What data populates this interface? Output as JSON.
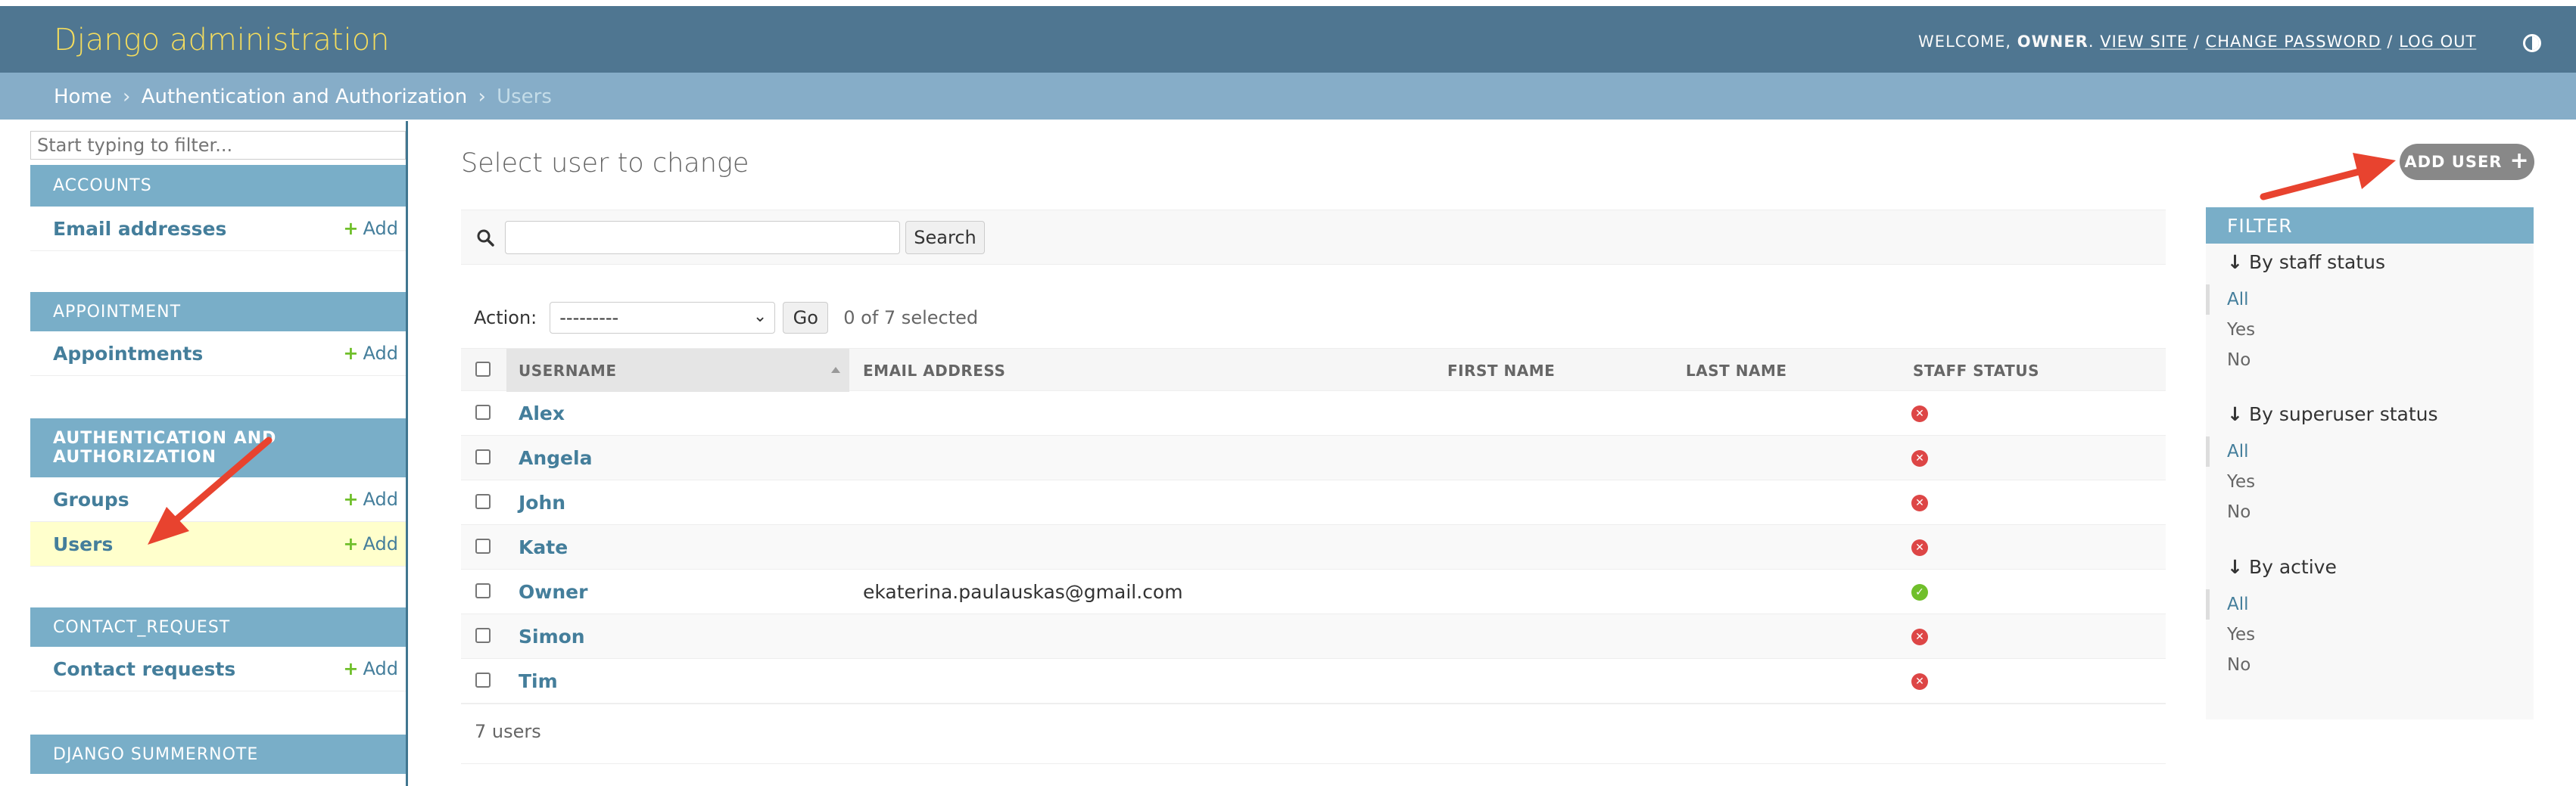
{
  "header": {
    "branding": "Django administration",
    "welcome": "Welcome,",
    "username": "Owner",
    "view_site": "View site",
    "change_password": "Change password",
    "log_out": "Log out",
    "separator": "/"
  },
  "breadcrumbs": {
    "home": "Home",
    "app": "Authentication and Authorization",
    "current": "Users",
    "separator": "›"
  },
  "sidebar": {
    "filter_placeholder": "Start typing to filter...",
    "modules": [
      {
        "caption": "Accounts",
        "models": [
          {
            "label": "Email addresses",
            "add": "Add"
          }
        ]
      },
      {
        "caption": "Appointment",
        "models": [
          {
            "label": "Appointments",
            "add": "Add"
          }
        ]
      },
      {
        "caption": "Authentication and Authorization",
        "models": [
          {
            "label": "Groups",
            "add": "Add"
          },
          {
            "label": "Users",
            "add": "Add"
          }
        ]
      },
      {
        "caption": "Contact_Request",
        "models": [
          {
            "label": "Contact requests",
            "add": "Add"
          }
        ]
      },
      {
        "caption": "Django Summernote",
        "models": []
      }
    ]
  },
  "main": {
    "title": "Select user to change",
    "add_user": "Add user",
    "search_button": "Search",
    "action_label": "Action:",
    "action_selected": "---------",
    "go_button": "Go",
    "selected_counter": "0 of 7 selected",
    "columns": [
      "Username",
      "Email address",
      "First name",
      "Last name",
      "Staff status"
    ],
    "rows": [
      {
        "username": "Alex",
        "email": "",
        "first_name": "",
        "last_name": "",
        "staff": false
      },
      {
        "username": "Angela",
        "email": "",
        "first_name": "",
        "last_name": "",
        "staff": false
      },
      {
        "username": "John",
        "email": "",
        "first_name": "",
        "last_name": "",
        "staff": false
      },
      {
        "username": "Kate",
        "email": "",
        "first_name": "",
        "last_name": "",
        "staff": false
      },
      {
        "username": "Owner",
        "email": "ekaterina.paulauskas@gmail.com",
        "first_name": "",
        "last_name": "",
        "staff": true
      },
      {
        "username": "Simon",
        "email": "",
        "first_name": "",
        "last_name": "",
        "staff": false
      },
      {
        "username": "Tim",
        "email": "",
        "first_name": "",
        "last_name": "",
        "staff": false
      }
    ],
    "paginator": "7 users"
  },
  "filter": {
    "title": "Filter",
    "groups": [
      {
        "heading": "By staff status",
        "options": [
          "All",
          "Yes",
          "No"
        ],
        "selected": "All"
      },
      {
        "heading": "By superuser status",
        "options": [
          "All",
          "Yes",
          "No"
        ],
        "selected": "All"
      },
      {
        "heading": "By active",
        "options": [
          "All",
          "Yes",
          "No"
        ],
        "selected": "All"
      }
    ]
  },
  "colors": {
    "header_bg": "#4f7691",
    "branding": "#f5dd5d",
    "breadcrumbs_bg": "#86adc8",
    "caption_bg": "#79aec8",
    "link": "#447e9b",
    "add_green": "#70bf2b",
    "status_no": "#dd4646",
    "status_yes": "#70bf2b",
    "annotation_arrow": "#e8432f"
  },
  "icons": {
    "search": "search-icon",
    "theme": "theme-toggle-icon",
    "sort": "sort-ascending-icon",
    "status_yes": "yes-icon",
    "status_no": "no-icon",
    "add": "plus-icon",
    "filter_heading": "arrow-down-icon"
  }
}
